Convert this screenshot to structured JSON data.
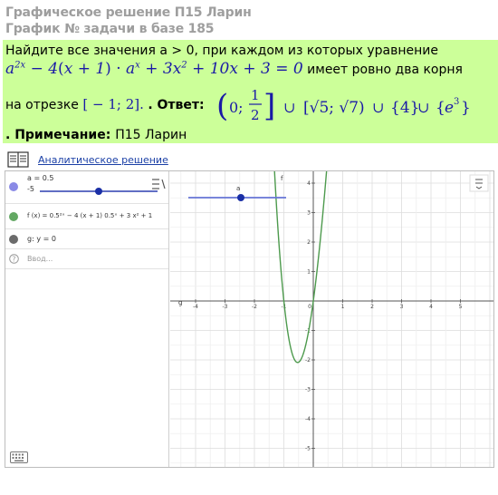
{
  "header": {
    "title": "Графическое решение П15 Ларин",
    "subtitle": "График № задачи в базе 185"
  },
  "task": {
    "line1": "Найдите все значения a > 0, при каждом из которых уравнение",
    "eq_after": "имеет ровно два корня",
    "line3_start": "на отрезке",
    "segment": "[ − 1; 2].",
    "answer_label": ". Ответ:",
    "note_label": ". Примечание:",
    "note_value": "П15 Ларин"
  },
  "link": {
    "label": "Аналитическое решение"
  },
  "algebra": {
    "slider_a": "a = 0.5",
    "slider_min": "-5",
    "function_f": "f (x) = 0.5²ˣ − 4 (x + 1) 0.5ˣ + 3 x² + 1",
    "line_g": "g: y = 0",
    "input_placeholder": "Ввод..."
  },
  "graphics": {
    "slider_label": "a",
    "f_label": "f",
    "g_label": "g",
    "x_ticks": [
      "-4",
      "-3",
      "-2",
      "-1",
      "0",
      "1",
      "2",
      "3",
      "4",
      "5"
    ],
    "y_ticks": [
      "4",
      "3",
      "2",
      "1",
      "-1",
      "-2",
      "-3",
      "-4",
      "-5"
    ]
  },
  "colors": {
    "task_bg": "#ccff99",
    "math": "#1a1aa6",
    "curve": "#4d9a4d",
    "slider": "#2b3fb0"
  }
}
